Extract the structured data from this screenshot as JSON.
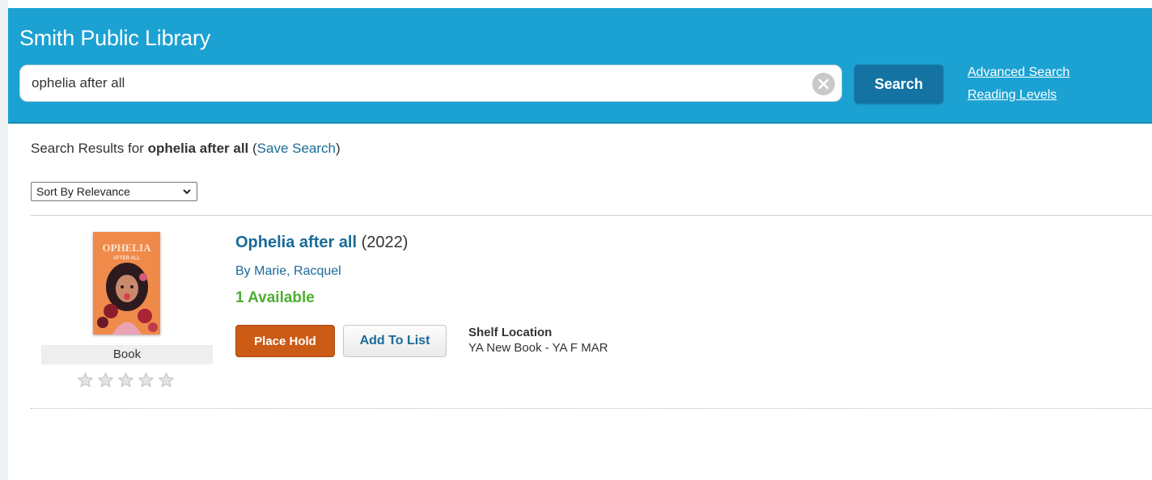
{
  "header": {
    "title": "Smith Public Library",
    "search_value": "ophelia after all",
    "search_button": "Search",
    "links": [
      "Advanced Search",
      "Reading Levels"
    ],
    "bg_color": "#1ca2d2"
  },
  "results": {
    "prefix": "Search Results for ",
    "term": "ophelia after all",
    "save_open": " (",
    "save_link": "Save Search",
    "save_close": ")"
  },
  "sort": {
    "selected": "Sort By Relevance"
  },
  "item": {
    "cover_title": "OPHELIA",
    "cover_subtitle": "AFTER ALL",
    "title": "Ophelia after all",
    "year": "(2022)",
    "author": "By Marie, Racquel",
    "availability": "1 Available",
    "availability_color": "#4dae32",
    "format": "Book",
    "rating_stars": 5,
    "rating_value": 0,
    "place_hold": "Place Hold",
    "add_to_list": "Add To List",
    "shelf_label": "Shelf Location",
    "shelf_value": "YA New Book - YA F MAR"
  },
  "icons": {
    "clear": "clear-icon",
    "sort_chevron": "chevron-down-icon",
    "star": "star-icon"
  }
}
